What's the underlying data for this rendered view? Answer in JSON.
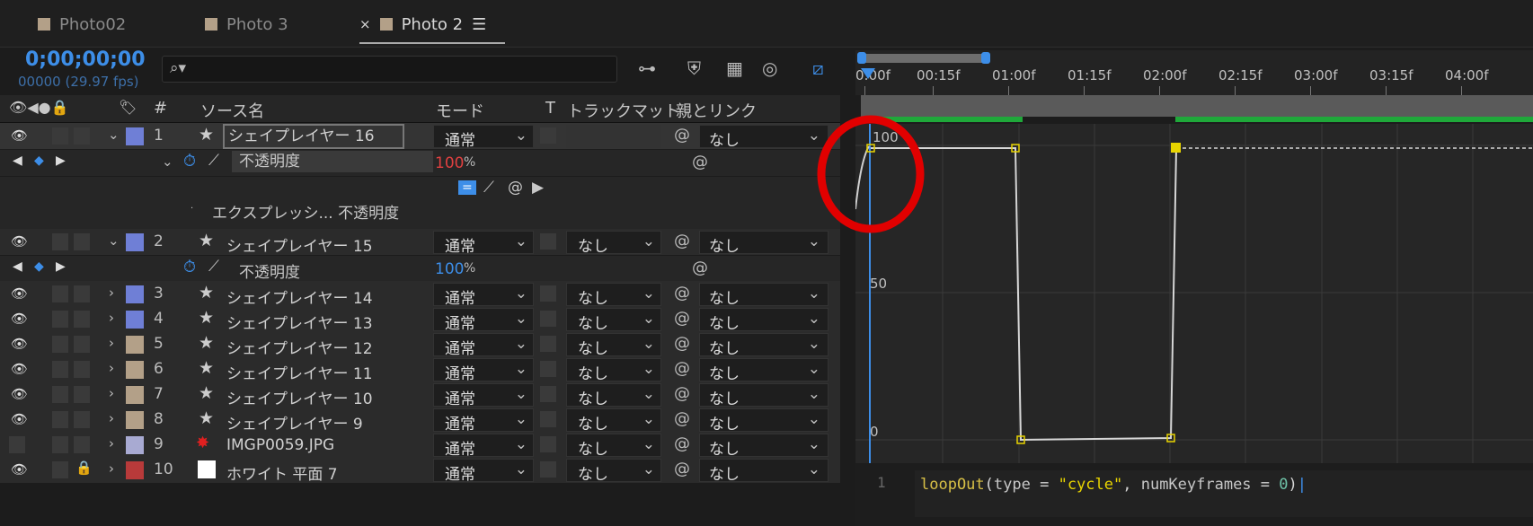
{
  "tabs": [
    {
      "label": "Photo02",
      "active": false
    },
    {
      "label": "Photo 3",
      "active": false
    },
    {
      "label": "Photo 2",
      "active": true
    }
  ],
  "header": {
    "timecode": "0;00;00;00",
    "fps": "00000 (29.97 fps)",
    "search_placeholder": ""
  },
  "columns": {
    "num": "#",
    "source": "ソース名",
    "mode": "モード",
    "t": "T",
    "trackmatte": "トラックマット",
    "parent": "親とリンク"
  },
  "layers": [
    {
      "num": "1",
      "name": "シェイプレイヤー 16",
      "mode": "通常",
      "track": "",
      "parent": "なし",
      "color": "#6f7fd6"
    },
    {
      "num": "2",
      "name": "シェイプレイヤー 15",
      "mode": "通常",
      "track": "なし",
      "parent": "なし",
      "color": "#6f7fd6"
    },
    {
      "num": "3",
      "name": "シェイプレイヤー 14",
      "mode": "通常",
      "track": "なし",
      "parent": "なし",
      "color": "#6f7fd6"
    },
    {
      "num": "4",
      "name": "シェイプレイヤー 13",
      "mode": "通常",
      "track": "なし",
      "parent": "なし",
      "color": "#6f7fd6"
    },
    {
      "num": "5",
      "name": "シェイプレイヤー 12",
      "mode": "通常",
      "track": "なし",
      "parent": "なし",
      "color": "#b3a088"
    },
    {
      "num": "6",
      "name": "シェイプレイヤー 11",
      "mode": "通常",
      "track": "なし",
      "parent": "なし",
      "color": "#b3a088"
    },
    {
      "num": "7",
      "name": "シェイプレイヤー 10",
      "mode": "通常",
      "track": "なし",
      "parent": "なし",
      "color": "#b3a088"
    },
    {
      "num": "8",
      "name": "シェイプレイヤー 9",
      "mode": "通常",
      "track": "なし",
      "parent": "なし",
      "color": "#b3a088"
    },
    {
      "num": "9",
      "name": "IMGP0059.JPG",
      "mode": "通常",
      "track": "なし",
      "parent": "なし",
      "color": "#a8aad2"
    },
    {
      "num": "10",
      "name": "ホワイト 平面 7",
      "mode": "通常",
      "track": "なし",
      "parent": "なし",
      "color": "#b83a3a"
    }
  ],
  "property1": {
    "name": "不透明度",
    "value": "100",
    "unit": "%"
  },
  "expression_label": "エクスプレッシ... 不透明度",
  "property2": {
    "name": "不透明度",
    "value": "100",
    "unit": "%"
  },
  "ruler_ticks": [
    "0:00f",
    "00:15f",
    "01:00f",
    "01:15f",
    "02:00f",
    "02:15f",
    "03:00f",
    "03:15f",
    "04:00f"
  ],
  "graph_labels": [
    "100",
    "50",
    "0"
  ],
  "code": {
    "line_number": "1",
    "func": "loopOut",
    "open": "(",
    "arg1": "type",
    "eq1": " = ",
    "str": "\"cycle\"",
    "comma": ", ",
    "arg2": "numKeyframes",
    "eq2": " = ",
    "num": "0",
    "close": ")"
  },
  "colors": {
    "accent": "#3d8ee8",
    "keyframe": "#e8d400",
    "highlight_circle": "#e10000",
    "green_bar": "#1fa83a"
  }
}
